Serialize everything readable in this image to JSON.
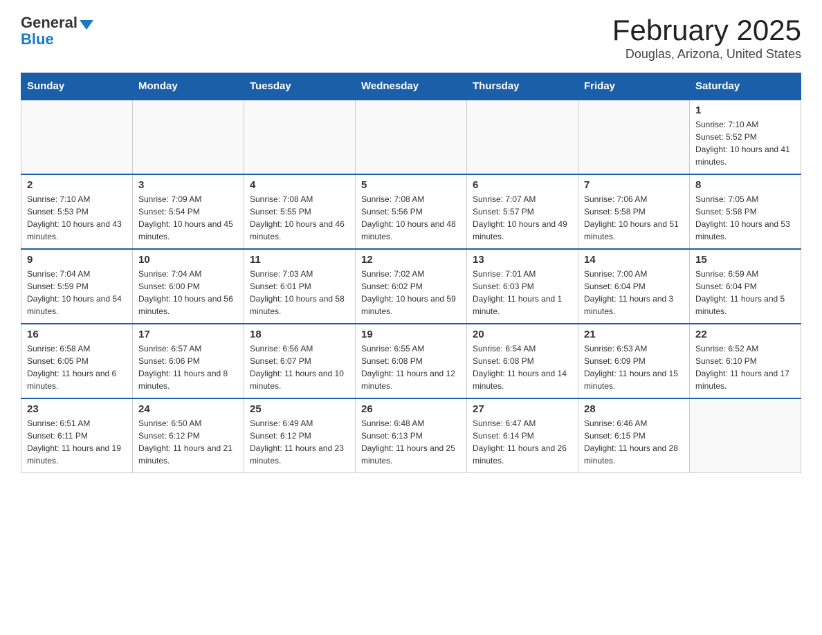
{
  "header": {
    "logo": {
      "general": "General",
      "blue": "Blue"
    },
    "title": "February 2025",
    "subtitle": "Douglas, Arizona, United States"
  },
  "days_of_week": [
    "Sunday",
    "Monday",
    "Tuesday",
    "Wednesday",
    "Thursday",
    "Friday",
    "Saturday"
  ],
  "weeks": [
    [
      {
        "day": "",
        "info": ""
      },
      {
        "day": "",
        "info": ""
      },
      {
        "day": "",
        "info": ""
      },
      {
        "day": "",
        "info": ""
      },
      {
        "day": "",
        "info": ""
      },
      {
        "day": "",
        "info": ""
      },
      {
        "day": "1",
        "info": "Sunrise: 7:10 AM\nSunset: 5:52 PM\nDaylight: 10 hours and 41 minutes."
      }
    ],
    [
      {
        "day": "2",
        "info": "Sunrise: 7:10 AM\nSunset: 5:53 PM\nDaylight: 10 hours and 43 minutes."
      },
      {
        "day": "3",
        "info": "Sunrise: 7:09 AM\nSunset: 5:54 PM\nDaylight: 10 hours and 45 minutes."
      },
      {
        "day": "4",
        "info": "Sunrise: 7:08 AM\nSunset: 5:55 PM\nDaylight: 10 hours and 46 minutes."
      },
      {
        "day": "5",
        "info": "Sunrise: 7:08 AM\nSunset: 5:56 PM\nDaylight: 10 hours and 48 minutes."
      },
      {
        "day": "6",
        "info": "Sunrise: 7:07 AM\nSunset: 5:57 PM\nDaylight: 10 hours and 49 minutes."
      },
      {
        "day": "7",
        "info": "Sunrise: 7:06 AM\nSunset: 5:58 PM\nDaylight: 10 hours and 51 minutes."
      },
      {
        "day": "8",
        "info": "Sunrise: 7:05 AM\nSunset: 5:58 PM\nDaylight: 10 hours and 53 minutes."
      }
    ],
    [
      {
        "day": "9",
        "info": "Sunrise: 7:04 AM\nSunset: 5:59 PM\nDaylight: 10 hours and 54 minutes."
      },
      {
        "day": "10",
        "info": "Sunrise: 7:04 AM\nSunset: 6:00 PM\nDaylight: 10 hours and 56 minutes."
      },
      {
        "day": "11",
        "info": "Sunrise: 7:03 AM\nSunset: 6:01 PM\nDaylight: 10 hours and 58 minutes."
      },
      {
        "day": "12",
        "info": "Sunrise: 7:02 AM\nSunset: 6:02 PM\nDaylight: 10 hours and 59 minutes."
      },
      {
        "day": "13",
        "info": "Sunrise: 7:01 AM\nSunset: 6:03 PM\nDaylight: 11 hours and 1 minute."
      },
      {
        "day": "14",
        "info": "Sunrise: 7:00 AM\nSunset: 6:04 PM\nDaylight: 11 hours and 3 minutes."
      },
      {
        "day": "15",
        "info": "Sunrise: 6:59 AM\nSunset: 6:04 PM\nDaylight: 11 hours and 5 minutes."
      }
    ],
    [
      {
        "day": "16",
        "info": "Sunrise: 6:58 AM\nSunset: 6:05 PM\nDaylight: 11 hours and 6 minutes."
      },
      {
        "day": "17",
        "info": "Sunrise: 6:57 AM\nSunset: 6:06 PM\nDaylight: 11 hours and 8 minutes."
      },
      {
        "day": "18",
        "info": "Sunrise: 6:56 AM\nSunset: 6:07 PM\nDaylight: 11 hours and 10 minutes."
      },
      {
        "day": "19",
        "info": "Sunrise: 6:55 AM\nSunset: 6:08 PM\nDaylight: 11 hours and 12 minutes."
      },
      {
        "day": "20",
        "info": "Sunrise: 6:54 AM\nSunset: 6:08 PM\nDaylight: 11 hours and 14 minutes."
      },
      {
        "day": "21",
        "info": "Sunrise: 6:53 AM\nSunset: 6:09 PM\nDaylight: 11 hours and 15 minutes."
      },
      {
        "day": "22",
        "info": "Sunrise: 6:52 AM\nSunset: 6:10 PM\nDaylight: 11 hours and 17 minutes."
      }
    ],
    [
      {
        "day": "23",
        "info": "Sunrise: 6:51 AM\nSunset: 6:11 PM\nDaylight: 11 hours and 19 minutes."
      },
      {
        "day": "24",
        "info": "Sunrise: 6:50 AM\nSunset: 6:12 PM\nDaylight: 11 hours and 21 minutes."
      },
      {
        "day": "25",
        "info": "Sunrise: 6:49 AM\nSunset: 6:12 PM\nDaylight: 11 hours and 23 minutes."
      },
      {
        "day": "26",
        "info": "Sunrise: 6:48 AM\nSunset: 6:13 PM\nDaylight: 11 hours and 25 minutes."
      },
      {
        "day": "27",
        "info": "Sunrise: 6:47 AM\nSunset: 6:14 PM\nDaylight: 11 hours and 26 minutes."
      },
      {
        "day": "28",
        "info": "Sunrise: 6:46 AM\nSunset: 6:15 PM\nDaylight: 11 hours and 28 minutes."
      },
      {
        "day": "",
        "info": ""
      }
    ]
  ]
}
